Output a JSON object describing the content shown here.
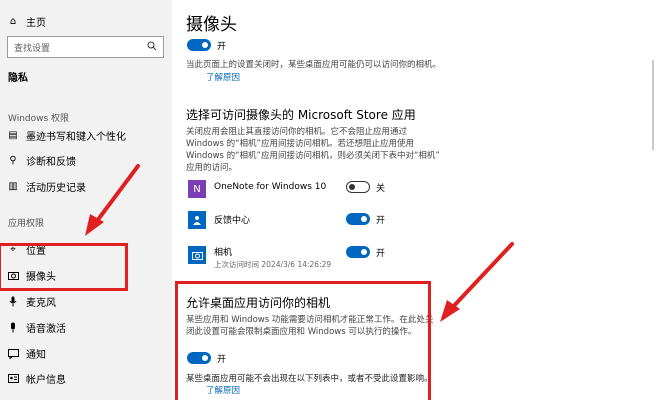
{
  "sidebar": {
    "home_label": "主页",
    "search_placeholder": "查找设置",
    "section_title": "隐私",
    "windows_permissions_label": "Windows 权限",
    "windows_items": [
      {
        "label": "墨迹书写和键入个性化",
        "icon": "pen-icon"
      },
      {
        "label": "诊断和反馈",
        "icon": "feedback-icon"
      },
      {
        "label": "活动历史记录",
        "icon": "history-icon"
      }
    ],
    "app_permissions_label": "应用权限",
    "app_items": [
      {
        "label": "位置",
        "icon": "location-icon"
      },
      {
        "label": "摄像头",
        "icon": "camera-icon"
      },
      {
        "label": "麦克风",
        "icon": "microphone-icon"
      },
      {
        "label": "语音激活",
        "icon": "voice-icon"
      },
      {
        "label": "通知",
        "icon": "notification-icon"
      },
      {
        "label": "帐户信息",
        "icon": "account-icon"
      }
    ]
  },
  "main": {
    "title": "摄像头",
    "top_toggle_label": "开",
    "top_desc": "当此页面上的设置关闭时，某些桌面应用可能仍可以访问你的相机。",
    "learn_more": "了解原因",
    "store_title": "选择可访问摄像头的 Microsoft Store 应用",
    "store_desc_lines": [
      "关闭应用会阻止其直接访问你的相机。它不会阻止应用通过",
      "Windows 的“相机”应用间接访问相机。若还想阻止应用使用",
      "Windows 的“相机”应用间接访问相机，则必须关闭下表中对“相机”",
      "应用的访问。"
    ],
    "apps": [
      {
        "name": "OneNote for Windows 10",
        "state_label": "关",
        "on": false,
        "sub": ""
      },
      {
        "name": "反馈中心",
        "state_label": "开",
        "on": true,
        "sub": ""
      },
      {
        "name": "相机",
        "state_label": "开",
        "on": true,
        "sub": "上次访问时间 2024/3/6 14:26:29"
      }
    ],
    "desktop_title": "允许桌面应用访问你的相机",
    "desktop_desc_lines": [
      "某些应用和 Windows 功能需要访问相机才能正常工作。在此处关",
      "闭此设置可能会限制桌面应用和 Windows 可以执行的操作。"
    ],
    "desktop_toggle_label": "开",
    "bottom_note": "某些桌面应用可能不会出现在以下列表中，或者不受此设置影响。",
    "bottom_learn_more": "了解原因"
  },
  "colors": {
    "accent": "#0067c0",
    "highlight": "#e02020",
    "link": "#0067b8"
  }
}
